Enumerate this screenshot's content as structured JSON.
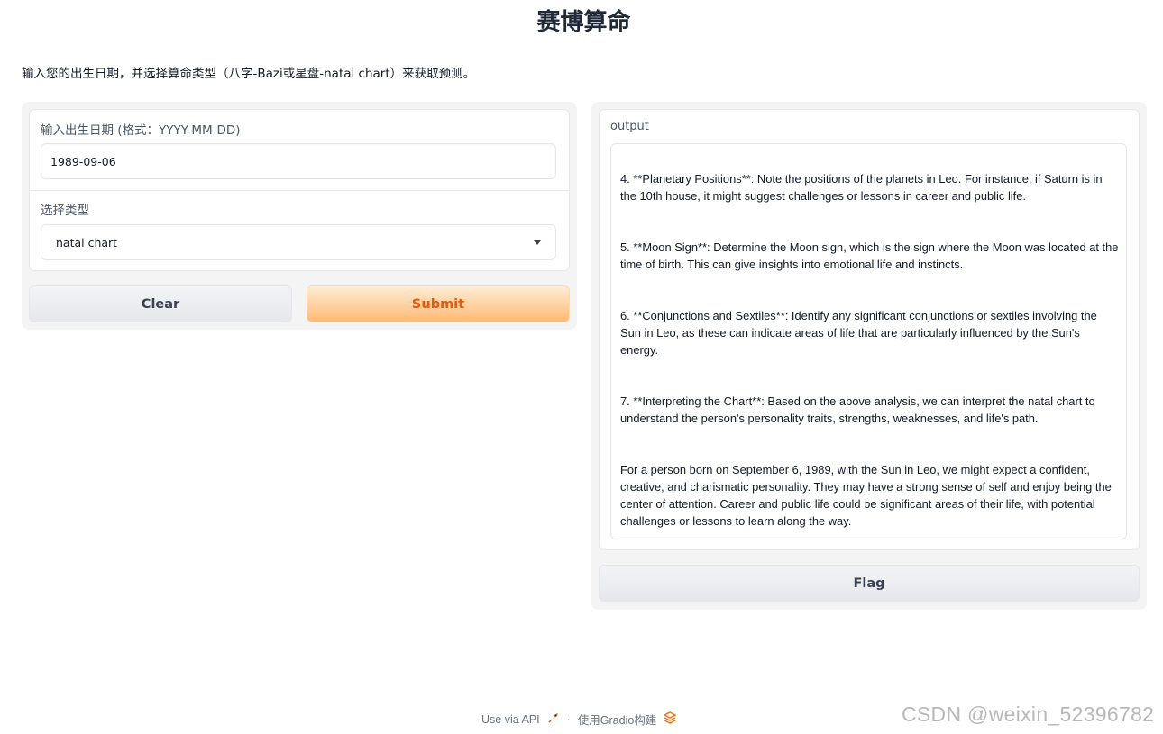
{
  "title": "赛博算命",
  "description": "输入您的出生日期，并选择算命类型（八字-Bazi或星盘-natal chart）来获取预测。",
  "form": {
    "birthdate_label": "输入出生日期 (格式：YYYY-MM-DD)",
    "birthdate_value": "1989-09-06",
    "type_label": "选择类型",
    "type_value": "natal chart",
    "clear_label": "Clear",
    "submit_label": "Submit"
  },
  "output": {
    "label": "output",
    "paragraphs": [
      "4. **Planetary Positions**: Note the positions of the planets in Leo. For instance, if Saturn is in the 10th house, it might suggest challenges or lessons in career and public life.",
      "5. **Moon Sign**: Determine the Moon sign, which is the sign where the Moon was located at the time of birth. This can give insights into emotional life and instincts.",
      "6. **Conjunctions and Sextiles**: Identify any significant conjunctions or sextiles involving the Sun in Leo, as these can indicate areas of life that are particularly influenced by the Sun's energy.",
      "7. **Interpreting the Chart**: Based on the above analysis, we can interpret the natal chart to understand the person's personality traits, strengths, weaknesses, and life's path.",
      "For a person born on September 6, 1989, with the Sun in Leo, we might expect a confident, creative, and charismatic personality. They may have a strong sense of self and enjoy being the center of attention. Career and public life could be significant areas of their life, with potential challenges or lessons to learn along the way."
    ],
    "flag_label": "Flag"
  },
  "footer": {
    "api_label": "Use via API",
    "separator": "·",
    "built_with_label": "使用Gradio构建"
  },
  "watermark": "CSDN @weixin_52396782",
  "colors": {
    "submit_text": "#ea580c",
    "submit_bg": "#fdba74",
    "panel_bg": "#f4f4f5"
  },
  "icons": {
    "api": "rocket-icon",
    "gradio": "gradio-logo-icon",
    "dropdown": "caret-down-icon"
  }
}
